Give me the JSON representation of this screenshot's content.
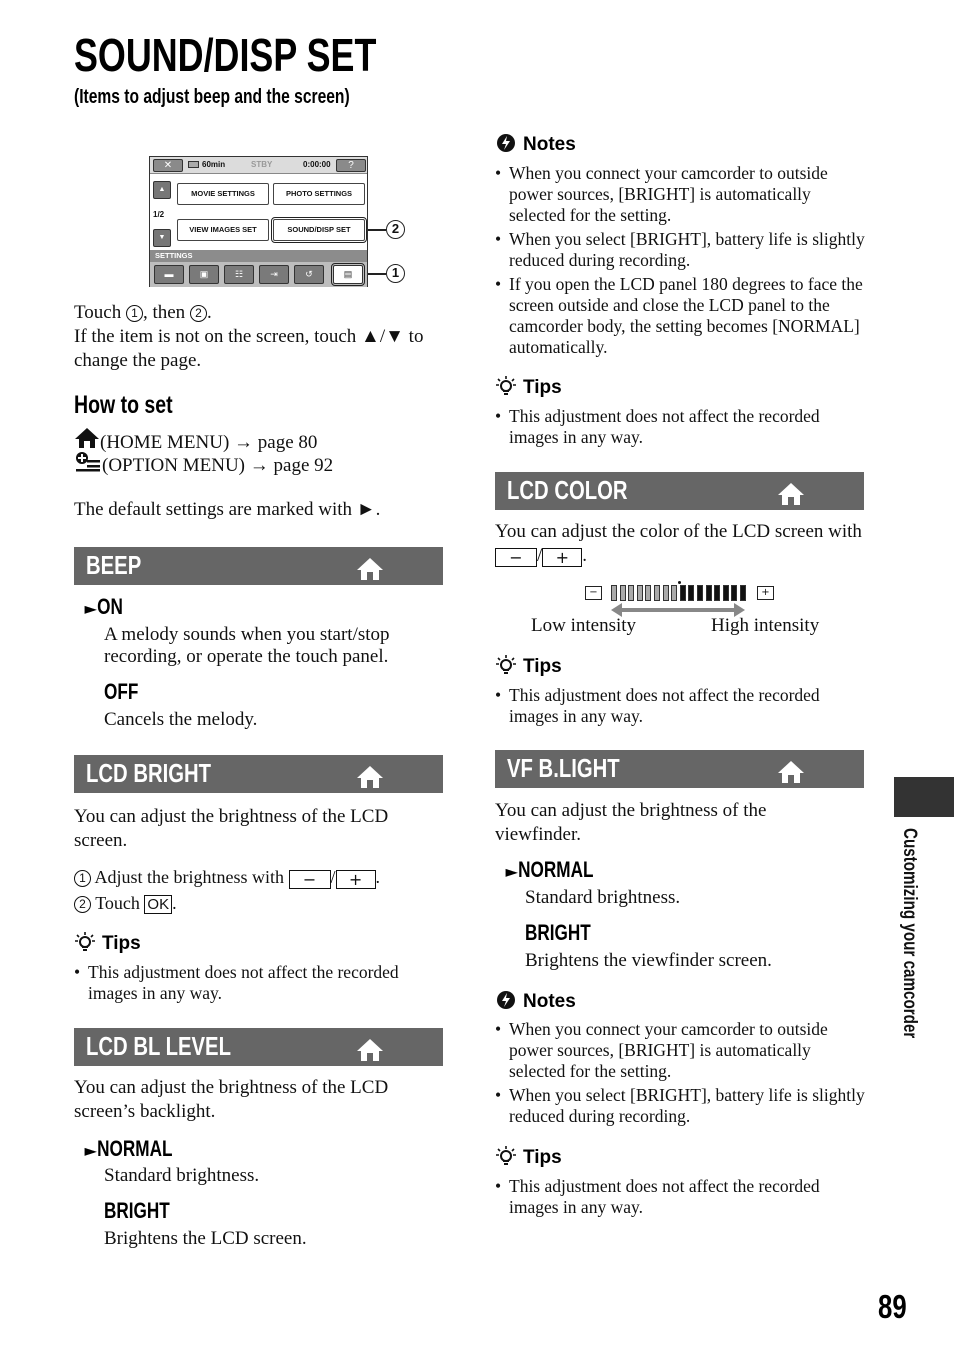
{
  "header": {
    "title": "SOUND/DISP SET",
    "subtitle": "(Items to adjust beep and the screen)"
  },
  "lcd_screen": {
    "close_label": "✕",
    "battery_text": "60min",
    "status": "STBY",
    "timecode": "0:00:00",
    "help_label": "?",
    "page_indicator": "1/2",
    "up_label": "▲",
    "down_label": "▼",
    "menu_buttons": [
      "MOVIE SETTINGS",
      "PHOTO SETTINGS",
      "VIEW IMAGES SET",
      "SOUND/DISP SET"
    ],
    "category_label": "SETTINGS",
    "category_tabs": [
      "camera-icon",
      "playback-icon",
      "list-icon",
      "input-icon",
      "connect-icon",
      "toolbox-icon"
    ],
    "callouts": [
      "2",
      "1"
    ]
  },
  "intro": {
    "touch_line_pre": "Touch ",
    "touch_num1": "1",
    "touch_line_mid": ", then ",
    "touch_num2": "2",
    "touch_line_end": ".",
    "page_change": "If the item is not on the screen, touch ▲/▼ to change the page."
  },
  "how_to_set": {
    "heading": "How to set",
    "home_menu": "(HOME MENU) → page 80",
    "option_menu": "(OPTION MENU) → page 92",
    "default_note": "The default settings are marked with ►."
  },
  "sections": {
    "beep": {
      "title": "BEEP",
      "options": [
        {
          "label": "ON",
          "default": true,
          "desc": "A melody sounds when you start/stop recording, or operate the touch panel."
        },
        {
          "label": "OFF",
          "default": false,
          "desc": "Cancels the melody."
        }
      ]
    },
    "lcd_bright": {
      "title": "LCD BRIGHT",
      "intro": "You can adjust the brightness of the LCD screen.",
      "step1_num": "1",
      "step1": "Adjust the brightness with",
      "minus": "−",
      "plus": "+",
      "step2_num": "2",
      "step2": "Touch",
      "ok": "OK",
      "tips_heading": "Tips",
      "tips": [
        "This adjustment does not affect the recorded images in any way."
      ]
    },
    "lcd_bl_level": {
      "title": "LCD BL LEVEL",
      "intro": "You can adjust the brightness of the LCD screen’s backlight.",
      "options": [
        {
          "label": "NORMAL",
          "default": true,
          "desc": "Standard brightness."
        },
        {
          "label": "BRIGHT",
          "default": false,
          "desc": "Brightens the LCD screen."
        }
      ],
      "notes_heading": "Notes",
      "notes": [
        "When you connect your camcorder to outside power sources, [BRIGHT] is automatically selected for the setting.",
        "When you select [BRIGHT], battery life is slightly reduced during recording.",
        "If you open the LCD panel 180 degrees to face the screen outside and close the LCD panel to the camcorder body, the setting becomes [NORMAL] automatically."
      ],
      "tips_heading": "Tips",
      "tips": [
        "This adjustment does not affect the recorded images in any way."
      ]
    },
    "lcd_color": {
      "title": "LCD COLOR",
      "intro": "You can adjust the color of the LCD screen with",
      "minus": "−",
      "plus": "+",
      "scale": {
        "segments_total": 16,
        "segments_low": 8,
        "minus_label": "−",
        "plus_label": "+",
        "low_label": "Low intensity",
        "high_label": "High intensity"
      },
      "tips_heading": "Tips",
      "tips": [
        "This adjustment does not affect the recorded images in any way."
      ]
    },
    "vf_blight": {
      "title": "VF B.LIGHT",
      "intro": "You can adjust the brightness of the viewfinder.",
      "options": [
        {
          "label": "NORMAL",
          "default": true,
          "desc": "Standard brightness."
        },
        {
          "label": "BRIGHT",
          "default": false,
          "desc": "Brightens the viewfinder screen."
        }
      ],
      "notes_heading": "Notes",
      "notes": [
        "When you connect your camcorder to outside power sources, [BRIGHT] is automatically selected for the setting.",
        "When you select [BRIGHT], battery life is slightly reduced during recording."
      ],
      "tips_heading": "Tips",
      "tips": [
        "This adjustment does not affect the recorded images in any way."
      ]
    }
  },
  "side_tab": {
    "label": "Customizing your camcorder"
  },
  "page_number": "89",
  "colors": {
    "section_bar": "#666666",
    "side_tab": "#333333",
    "scale_low": "#aaaaaa",
    "scale_high": "#111111"
  }
}
